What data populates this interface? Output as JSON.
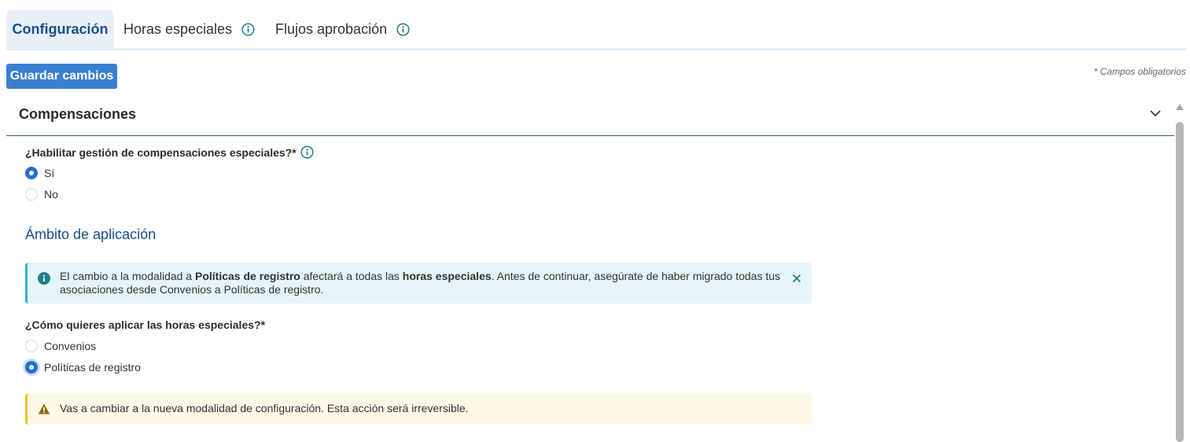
{
  "tabs": [
    {
      "label": "Configuración",
      "active": true,
      "info": false
    },
    {
      "label": "Horas especiales",
      "active": false,
      "info": true
    },
    {
      "label": "Flujos aprobación",
      "active": false,
      "info": true
    }
  ],
  "toolbar": {
    "save_label": "Guardar cambios",
    "required_note": "* Campos obligatorios"
  },
  "section": {
    "title": "Compensaciones",
    "expanded": true
  },
  "compensation_question": {
    "label": "¿Habilitar gestión de compensaciones especiales?*",
    "options": [
      {
        "label": "Sí",
        "checked": true
      },
      {
        "label": "No",
        "checked": false
      }
    ]
  },
  "scope": {
    "heading": "Ámbito de aplicación",
    "info_alert": {
      "part1": "El cambio a la modalidad a ",
      "bold1": "Políticas de registro",
      "part2": " afectará a todas las ",
      "bold2": "horas especiales",
      "part3": ". Antes de continuar, asegúrate de haber migrado todas tus asociaciones desde Convenios a Políticas de registro."
    },
    "question": {
      "label": "¿Cómo quieres aplicar las horas especiales?*",
      "options": [
        {
          "label": "Convenios",
          "checked": false
        },
        {
          "label": "Políticas de registro",
          "checked": true
        }
      ]
    },
    "warning_alert": "Vas a cambiar a la nueva modalidad de configuración. Esta acción será irreversible."
  },
  "colors": {
    "primary": "#3a7fd1",
    "tab_active": "#1a4f8c",
    "info_bg": "#e5f5fa",
    "info_border": "#2fb1c8",
    "warn_bg": "#fef8e6",
    "warn_border": "#f2c21b",
    "info_icon": "#1f7f88"
  },
  "icons": {
    "tab_info": "info-circle-icon",
    "chevron": "chevron-down-icon",
    "alert_info": "info-filled-icon",
    "alert_close": "close-icon",
    "alert_warn": "warning-triangle-icon"
  }
}
